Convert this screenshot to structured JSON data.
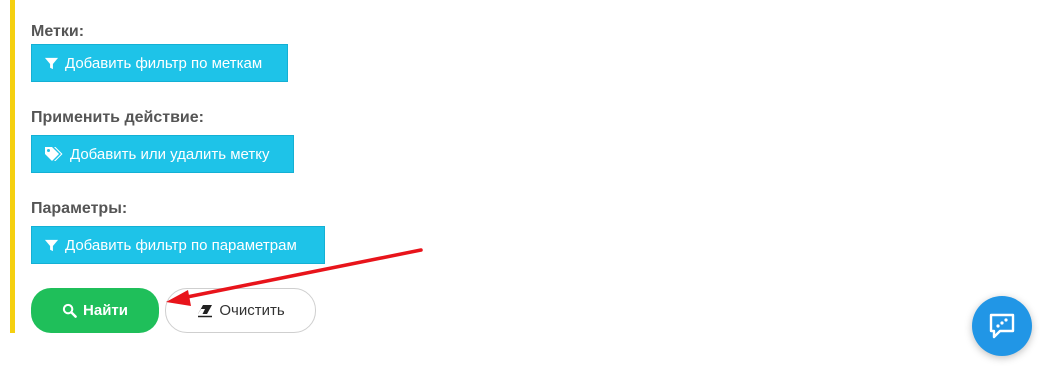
{
  "sections": {
    "tags": {
      "label": "Метки:",
      "button_label": "Добавить фильтр по меткам",
      "button_icon": "filter-icon"
    },
    "action": {
      "label": "Применить действие:",
      "button_label": "Добавить или удалить метку",
      "button_icon": "tags-icon"
    },
    "params": {
      "label": "Параметры:",
      "button_label": "Добавить фильтр по параметрам",
      "button_icon": "filter-icon"
    }
  },
  "actions": {
    "find_label": "Найти",
    "find_icon": "search-icon",
    "clear_label": "Очистить",
    "clear_icon": "eraser-icon"
  },
  "chat_widget": {
    "icon": "chat-icon"
  },
  "colors": {
    "accent_bar": "#f5d010",
    "button_cyan": "#1ec3e8",
    "button_find": "#1fbf5a",
    "annotation_arrow": "#e8141b",
    "chat_widget": "#2196e6"
  }
}
